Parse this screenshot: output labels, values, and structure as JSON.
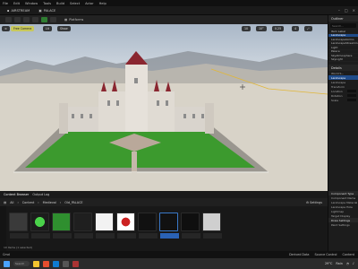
{
  "menu": {
    "items": [
      "File",
      "Edit",
      "Window",
      "Tools",
      "Build",
      "Select",
      "Actor",
      "Help"
    ]
  },
  "titlebar": {
    "tab1": "AIRSTREAM",
    "tab2": "PALACE"
  },
  "toolbar": {
    "platforms": "Platforms"
  },
  "viewport": {
    "mode": "Perspective",
    "lit": "Lit",
    "show": "Show",
    "snap": "10",
    "grid": "10°",
    "scale": "0.25",
    "cam": "4",
    "highlight": "Free Camera"
  },
  "outliner": {
    "title": "Outliner",
    "search": "Search...",
    "rows": [
      "Item Label",
      "Landscape",
      "LandscapeGizmo",
      "LandscapeStreaming",
      "Light",
      "Palace",
      "SkyAtmosphere",
      "SkyLight"
    ]
  },
  "details": {
    "title": "Details",
    "world": "World S...",
    "selected": "Landscape",
    "rows": [
      "Landscape",
      "Transform",
      "Location",
      "Rotation",
      "Scale"
    ]
  },
  "content_browser": {
    "tabs": [
      "Content Browser",
      "Output Log"
    ],
    "path": [
      "All",
      "Content",
      "Medieval",
      "Old_PALACE"
    ],
    "settings": "Settings",
    "status": "10 items (1 selected)"
  },
  "details_side": {
    "rows": [
      "Component Type",
      "Component Name",
      "Landscape Material",
      "Landscape Hole",
      "Lightmap",
      "Target Display",
      "Draw Settings",
      "Paint Settings"
    ]
  },
  "statusbar": {
    "left": "Cmd",
    "right": [
      "Derived Data",
      "Source Control",
      "Content"
    ]
  },
  "taskbar": {
    "search": "Search",
    "temp": "29°C",
    "time": "Rain"
  },
  "colors": {
    "accent": "#1f4b8a",
    "grass": "#3c9a2e",
    "palace": "#d9d4cd",
    "roof": "#8a2630"
  }
}
